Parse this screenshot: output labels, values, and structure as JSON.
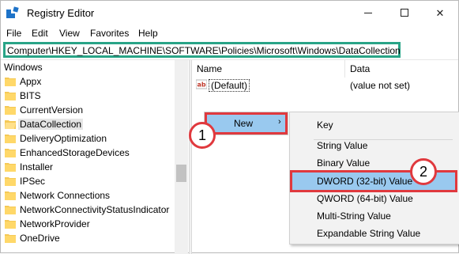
{
  "window": {
    "title": "Registry Editor",
    "minimize_glyph": "",
    "close_glyph": "✕"
  },
  "menu": [
    "File",
    "Edit",
    "View",
    "Favorites",
    "Help"
  ],
  "address": "Computer\\HKEY_LOCAL_MACHINE\\SOFTWARE\\Policies\\Microsoft\\Windows\\DataCollection",
  "tree": {
    "header": "Windows",
    "items": [
      "Appx",
      "BITS",
      "CurrentVersion",
      "DataCollection",
      "DeliveryOptimization",
      "EnhancedStorageDevices",
      "Installer",
      "IPSec",
      "Network Connections",
      "NetworkConnectivityStatusIndicator",
      "NetworkProvider",
      "OneDrive"
    ],
    "selected": "DataCollection"
  },
  "values": {
    "columns": [
      "Name",
      "Data"
    ],
    "rows": [
      {
        "name": "(Default)",
        "data": "(value not set)",
        "icon": "string-value-icon"
      }
    ]
  },
  "context_menu": {
    "new_label": "New",
    "submenu_arrow": "›",
    "submenu": [
      "Key",
      "String Value",
      "Binary Value",
      "DWORD (32-bit) Value",
      "QWORD (64-bit) Value",
      "Multi-String Value",
      "Expandable String Value"
    ],
    "highlighted": "DWORD (32-bit) Value"
  },
  "annotations": {
    "step1": "1",
    "step2": "2",
    "highlight_color": "#e0393e",
    "address_highlight_color": "#29a487"
  }
}
